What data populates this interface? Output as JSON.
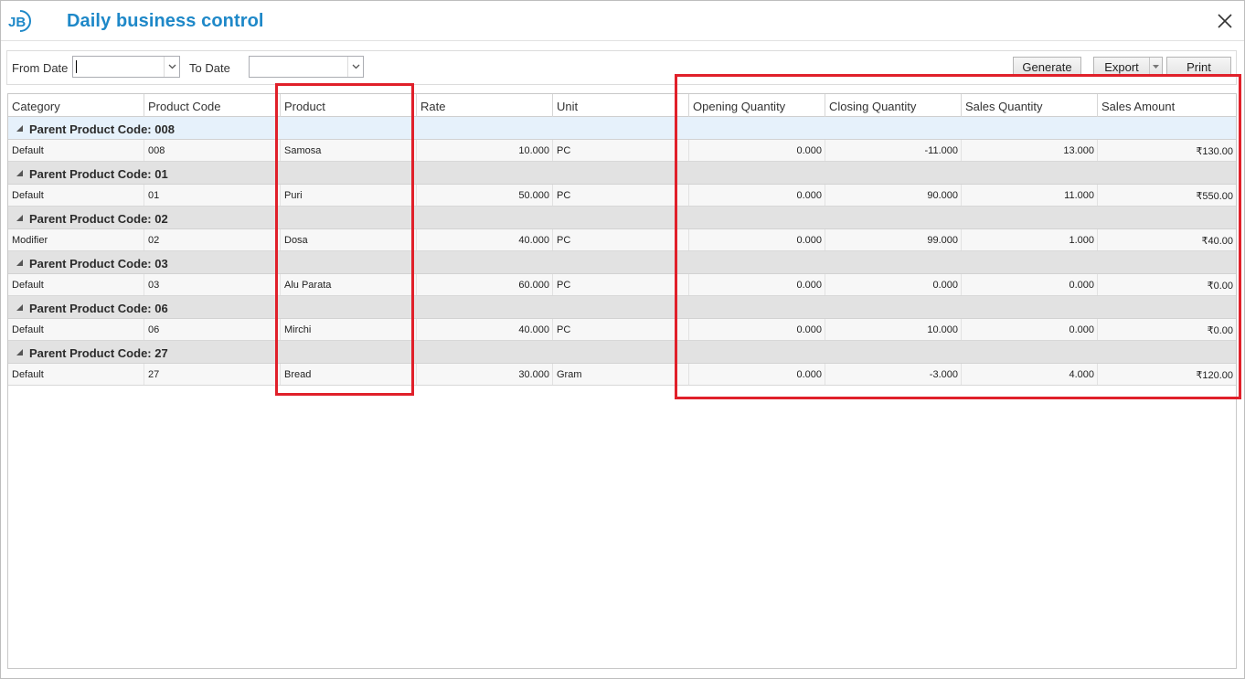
{
  "window": {
    "title": "Daily business control"
  },
  "toolbar": {
    "from_date_label": "From Date",
    "from_date_value": "",
    "to_date_label": "To Date",
    "to_date_value": "",
    "generate_label": "Generate",
    "export_label": "Export",
    "print_label": "Print"
  },
  "grid": {
    "columns": [
      "Category",
      "Product Code",
      "Product",
      "Rate",
      "Unit",
      "Opening Quantity",
      "Closing Quantity",
      "Sales Quantity",
      "Sales Amount"
    ],
    "groups": [
      {
        "label": "Parent Product Code: 008",
        "row": [
          "Default",
          "008",
          "Samosa",
          "10.000",
          "PC",
          "0.000",
          "-11.000",
          "13.000",
          "₹130.00"
        ]
      },
      {
        "label": "Parent Product Code: 01",
        "row": [
          "Default",
          "01",
          "Puri",
          "50.000",
          "PC",
          "0.000",
          "90.000",
          "11.000",
          "₹550.00"
        ]
      },
      {
        "label": "Parent Product Code: 02",
        "row": [
          "Modifier",
          "02",
          "Dosa",
          "40.000",
          "PC",
          "0.000",
          "99.000",
          "1.000",
          "₹40.00"
        ]
      },
      {
        "label": "Parent Product Code: 03",
        "row": [
          "Default",
          "03",
          "Alu Parata",
          "60.000",
          "PC",
          "0.000",
          "0.000",
          "0.000",
          "₹0.00"
        ]
      },
      {
        "label": "Parent Product Code: 06",
        "row": [
          "Default",
          "06",
          "Mirchi",
          "40.000",
          "PC",
          "0.000",
          "10.000",
          "0.000",
          "₹0.00"
        ]
      },
      {
        "label": "Parent Product Code: 27",
        "row": [
          "Default",
          "27",
          "Bread",
          "30.000",
          "Gram",
          "0.000",
          "-3.000",
          "4.000",
          "₹120.00"
        ]
      }
    ]
  },
  "colors": {
    "title": "#1e88c8",
    "highlight": "#e0202a",
    "group_bg": "#e2e2e2",
    "group_bg_selected": "#e6f1fb"
  },
  "icons": {
    "logo": "jb-logo",
    "close": "close-icon",
    "dropdown": "chevron-down-icon",
    "expander": "collapse-triangle-icon"
  }
}
